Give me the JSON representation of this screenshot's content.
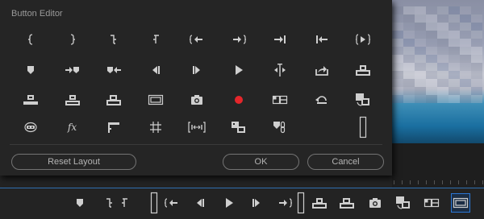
{
  "dialog": {
    "title": "Button Editor",
    "reset_label": "Reset Layout",
    "ok_label": "OK",
    "cancel_label": "Cancel"
  },
  "grid": {
    "rows": [
      [
        "add-marker-in-icon",
        "add-marker-out-icon",
        "mark-in-icon",
        "mark-out-icon",
        "go-to-in-icon",
        "go-to-out-icon",
        "go-to-out-point-icon",
        "go-to-in-point-icon",
        "play-in-to-out-icon"
      ],
      [
        "add-marker-icon",
        "go-to-next-marker-icon",
        "go-to-previous-marker-icon",
        "step-back-icon",
        "step-forward-icon",
        "play-stop-icon",
        "shuttle-icon",
        "export-icon",
        "insert-icon"
      ],
      [
        "lift-icon",
        "extract-icon",
        "overwrite-icon",
        "safe-margins-icon",
        "export-frame-icon",
        "record-icon",
        "multi-camera-icon",
        "loop-icon",
        "comparison-view-icon"
      ],
      [
        "vr-video-icon",
        "fx-icon",
        "timecode-ruler-icon",
        "grid-icon",
        "trim-icon",
        "track-select-icon",
        "proxy-toggle-icon",
        "",
        "spacer-icon"
      ]
    ],
    "record_color": "#e5262b",
    "fx_label": "fx"
  },
  "toolbar": {
    "buttons": [
      "add-marker-icon",
      "mark-in-icon",
      "mark-out-icon",
      "spacer-icon",
      "go-to-in-icon",
      "step-back-icon",
      "play-stop-icon",
      "step-forward-icon",
      "go-to-out-icon",
      "spacer-icon",
      "insert-icon",
      "overwrite-icon",
      "export-frame-icon",
      "comparison-view-icon",
      "multi-camera-icon",
      "safe-margins-icon"
    ],
    "active": "safe-margins-icon",
    "accent_color": "#2b77d6"
  }
}
